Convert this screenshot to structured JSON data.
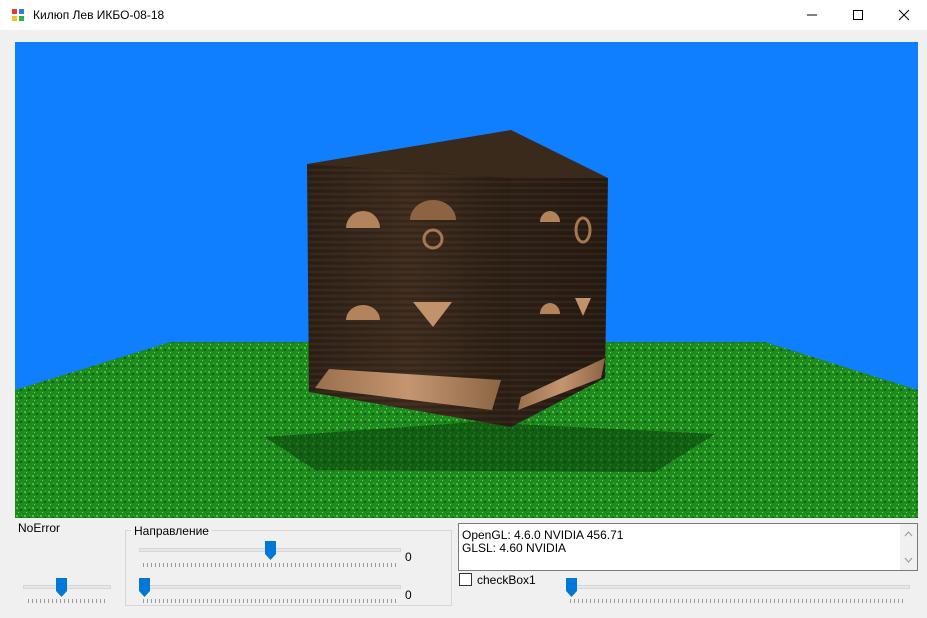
{
  "window": {
    "title": "Килюп Лев ИКБО-08-18",
    "icons": [
      "app-icon",
      "minimize-icon",
      "maximize-icon",
      "close-icon"
    ]
  },
  "colors": {
    "sky": "#0f7fff",
    "grass": "#1f8f1f",
    "wood": "#3a2a1c",
    "accent": "#0078d7"
  },
  "status": {
    "error_label": "NoError"
  },
  "direction_group": {
    "title": "Направление",
    "slider1": {
      "value_label": "0",
      "level": 0.5
    },
    "slider2": {
      "value_label": "0",
      "level": 0.0
    }
  },
  "left_slider": {
    "level": 0.45
  },
  "info": {
    "line1": "OpenGL: 4.6.0 NVIDIA 456.71",
    "line2": "GLSL: 4.60 NVIDIA"
  },
  "checkbox": {
    "label": "checkBox1",
    "checked": false
  },
  "right_slider": {
    "level": 0.0
  }
}
